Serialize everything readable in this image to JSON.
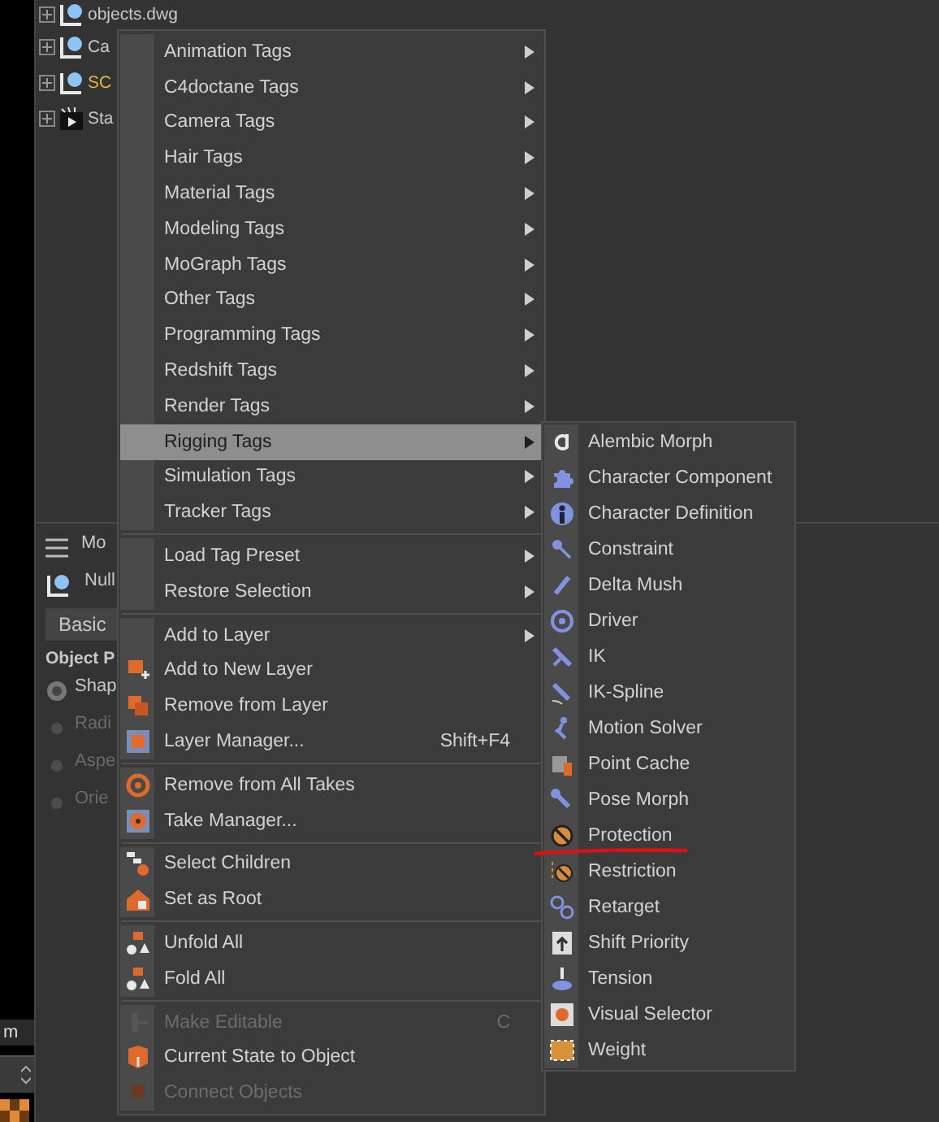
{
  "object_manager": {
    "rows": [
      {
        "name": "objects.dwg",
        "kind": "null",
        "highlighted": false
      },
      {
        "name": "Ca",
        "kind": "null",
        "highlighted": false
      },
      {
        "name": "SC",
        "kind": "null",
        "highlighted": true
      },
      {
        "name": "Sta",
        "kind": "stage",
        "highlighted": false
      }
    ]
  },
  "attributes": {
    "title": "Mo",
    "object": "Null",
    "tab": "Basic",
    "section": "Object P",
    "options": [
      {
        "label": "Shap",
        "selected": true,
        "disabled": false
      },
      {
        "label": "Radi",
        "selected": false,
        "disabled": true
      },
      {
        "label": "Aspe",
        "selected": false,
        "disabled": true
      },
      {
        "label": "Orie",
        "selected": false,
        "disabled": true
      }
    ]
  },
  "left_field": {
    "value": "m"
  },
  "context_menu": {
    "groups": [
      [
        {
          "label": "Animation Tags",
          "submenu": true,
          "selected": false
        },
        {
          "label": "C4doctane Tags",
          "submenu": true,
          "selected": false
        },
        {
          "label": "Camera Tags",
          "submenu": true,
          "selected": false
        },
        {
          "label": "Hair Tags",
          "submenu": true,
          "selected": false
        },
        {
          "label": "Material Tags",
          "submenu": true,
          "selected": false
        },
        {
          "label": "Modeling Tags",
          "submenu": true,
          "selected": false
        },
        {
          "label": "MoGraph Tags",
          "submenu": true,
          "selected": false
        },
        {
          "label": "Other Tags",
          "submenu": true,
          "selected": false
        },
        {
          "label": "Programming Tags",
          "submenu": true,
          "selected": false
        },
        {
          "label": "Redshift Tags",
          "submenu": true,
          "selected": false
        },
        {
          "label": "Render Tags",
          "submenu": true,
          "selected": false
        },
        {
          "label": "Rigging Tags",
          "submenu": true,
          "selected": true
        },
        {
          "label": "Simulation Tags",
          "submenu": true,
          "selected": false
        },
        {
          "label": "Tracker Tags",
          "submenu": true,
          "selected": false
        }
      ],
      [
        {
          "label": "Load Tag Preset",
          "submenu": true,
          "selected": false
        },
        {
          "label": "Restore Selection",
          "submenu": true,
          "selected": false
        }
      ],
      [
        {
          "label": "Add to Layer",
          "submenu": true,
          "selected": false
        },
        {
          "label": "Add to New Layer",
          "submenu": false,
          "selected": false
        },
        {
          "label": "Remove from Layer",
          "submenu": false,
          "selected": false
        },
        {
          "label": "Layer Manager...",
          "shortcut": "Shift+F4",
          "submenu": false,
          "selected": false
        }
      ],
      [
        {
          "label": "Remove from All Takes",
          "submenu": false,
          "selected": false
        },
        {
          "label": "Take Manager...",
          "submenu": false,
          "selected": false
        }
      ],
      [
        {
          "label": "Select Children",
          "submenu": false,
          "selected": false
        },
        {
          "label": "Set as Root",
          "submenu": false,
          "selected": false
        }
      ],
      [
        {
          "label": "Unfold All",
          "submenu": false,
          "selected": false
        },
        {
          "label": "Fold All",
          "submenu": false,
          "selected": false
        }
      ],
      [
        {
          "label": "Make Editable",
          "shortcut": "C",
          "submenu": false,
          "selected": false,
          "disabled": true
        },
        {
          "label": "Current State to Object",
          "submenu": false,
          "selected": false
        },
        {
          "label": "Connect Objects",
          "submenu": false,
          "selected": false,
          "disabled": true
        }
      ]
    ]
  },
  "submenu": {
    "items": [
      {
        "label": "Alembic Morph",
        "underlined": false
      },
      {
        "label": "Character Component",
        "underlined": false
      },
      {
        "label": "Character Definition",
        "underlined": false
      },
      {
        "label": "Constraint",
        "underlined": false
      },
      {
        "label": "Delta Mush",
        "underlined": false
      },
      {
        "label": "Driver",
        "underlined": false
      },
      {
        "label": "IK",
        "underlined": false
      },
      {
        "label": "IK-Spline",
        "underlined": false
      },
      {
        "label": "Motion Solver",
        "underlined": false
      },
      {
        "label": "Point Cache",
        "underlined": false
      },
      {
        "label": "Pose Morph",
        "underlined": false
      },
      {
        "label": "Protection",
        "underlined": true
      },
      {
        "label": "Restriction",
        "underlined": false
      },
      {
        "label": "Retarget",
        "underlined": false
      },
      {
        "label": "Shift Priority",
        "underlined": false
      },
      {
        "label": "Tension",
        "underlined": false
      },
      {
        "label": "Visual Selector",
        "underlined": false
      },
      {
        "label": "Weight",
        "underlined": false
      }
    ]
  }
}
